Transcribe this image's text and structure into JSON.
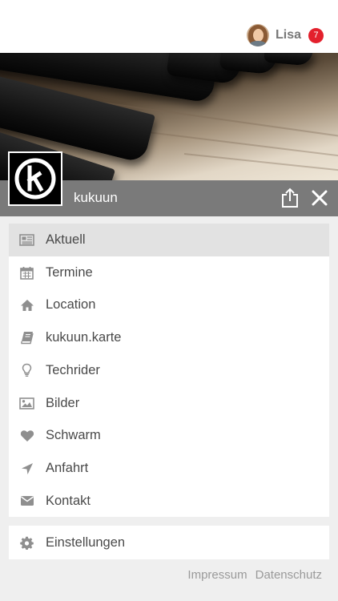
{
  "user": {
    "name": "Lisa",
    "notification_count": "7"
  },
  "venue": {
    "title": "kukuun"
  },
  "menu": {
    "items": [
      {
        "label": "Aktuell",
        "icon": "newspaper-icon",
        "active": true
      },
      {
        "label": "Termine",
        "icon": "calendar-icon"
      },
      {
        "label": "Location",
        "icon": "home-icon"
      },
      {
        "label": "kukuun.karte",
        "icon": "book-icon"
      },
      {
        "label": "Techrider",
        "icon": "lightbulb-icon"
      },
      {
        "label": "Bilder",
        "icon": "image-icon"
      },
      {
        "label": "Schwarm",
        "icon": "heart-icon"
      },
      {
        "label": "Anfahrt",
        "icon": "location-arrow-icon"
      },
      {
        "label": "Kontakt",
        "icon": "envelope-icon"
      }
    ]
  },
  "settings": {
    "label": "Einstellungen",
    "icon": "gear-icon"
  },
  "footer": {
    "impressum": "Impressum",
    "datenschutz": "Datenschutz"
  },
  "colors": {
    "badge": "#e3202c",
    "titlebar": "#7a7a7a",
    "active_item": "#e2e2e2",
    "icon_gray": "#8f8f8f"
  }
}
